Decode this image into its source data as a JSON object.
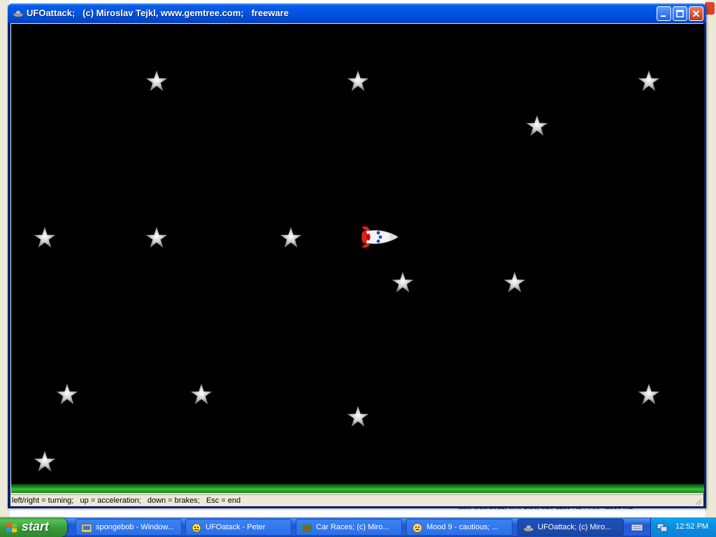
{
  "window": {
    "title": "UFOattack;   (c) Miroslav Tejkl, www.gemtree.com;   freeware",
    "status_text": "left/right = turning;   up = acceleration;   down = brakes;   Esc = end"
  },
  "game": {
    "stars": [
      {
        "id": "star-1"
      },
      {
        "id": "star-2"
      },
      {
        "id": "star-3"
      },
      {
        "id": "star-4"
      },
      {
        "id": "star-5"
      },
      {
        "id": "star-6"
      },
      {
        "id": "star-7"
      },
      {
        "id": "star-8"
      },
      {
        "id": "star-9"
      },
      {
        "id": "star-10"
      },
      {
        "id": "star-11"
      },
      {
        "id": "star-12"
      },
      {
        "id": "star-13"
      },
      {
        "id": "star-14"
      },
      {
        "id": "star-15"
      }
    ],
    "player": "rocket-ship"
  },
  "background_window": {
    "footer_text": "date 6/29/2012, time 2:58, size 1155 KB / free 41836 MB"
  },
  "taskbar": {
    "start_label": "start",
    "tasks": [
      {
        "label": "spongebob - Window...",
        "icon": "explorer-folder-icon",
        "active": false
      },
      {
        "label": "UFOatack - Peter",
        "icon": "peter-app-icon",
        "active": false
      },
      {
        "label": "Car Races;   (c) Miro...",
        "icon": "car-races-icon",
        "active": false
      },
      {
        "label": "Mood 9 - cautious;  ...",
        "icon": "smiley-icon",
        "active": false
      },
      {
        "label": "UFOattack;   (c) Miro...",
        "icon": "ufo-icon",
        "active": true
      }
    ],
    "clock": "12:52 PM"
  },
  "colors": {
    "game_background": "#000000",
    "titlebar_blue": "#0055e5",
    "taskbar_blue": "#245edb",
    "start_green": "#389a38",
    "grass_green": "#39c239"
  }
}
